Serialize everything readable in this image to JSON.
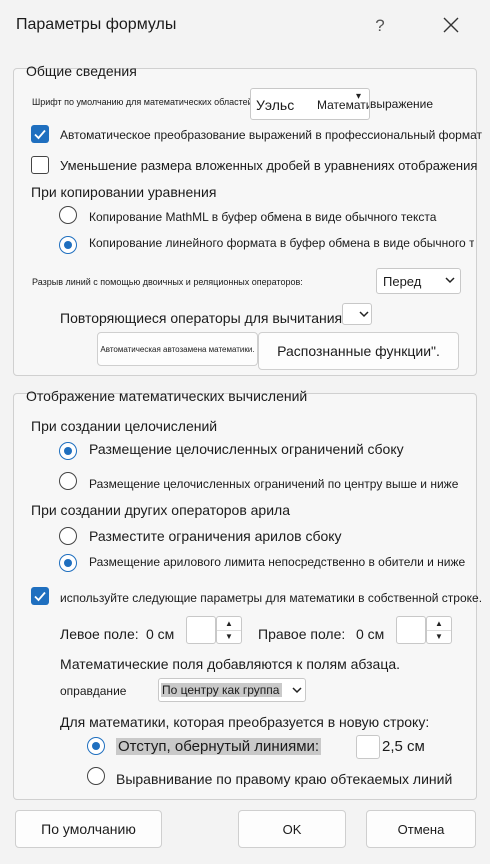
{
  "dialog": {
    "title": "Параметры формулы",
    "help": "?",
    "footer": {
      "defaults_label": "По умолчанию",
      "ok_label": "OK",
      "cancel_label": "Отмена"
    }
  },
  "general": {
    "legend": "Общие сведения",
    "default_font_label": "Шрифт по умолчанию для математических областей:",
    "default_font_value": "Уэльс",
    "default_font_value_tail": "Математическое выражение",
    "auto_convert_label": "Автоматическое преобразование выражений в профессиональный формат",
    "auto_convert_checked": true,
    "reduce_fractions_label": "Уменьшение размера вложенных дробей в уравнениях отображения",
    "reduce_fractions_checked": false,
    "copy_heading": "При копировании уравнения",
    "copy_mathml_label": "Копирование MathML в буфер обмена в виде обычного текста",
    "copy_linear_label": "Копирование линейного формата в буфер обмена в виде обычного текста",
    "copy_selected": "linear",
    "break_lines_label": "Разрыв линий с помощью двоичных и реляционных операторов:",
    "break_lines_value": "Перед",
    "repeat_ops_label": "Повторяющиеся операторы для вычитания:",
    "repeat_ops_value": "",
    "autocorrect_button": "Автоматическая автозамена математики.",
    "recognized_button": "Распознанные функции\"."
  },
  "display": {
    "legend": "Отображение математических вычислений",
    "integrals_heading": "При создании целочислений",
    "integral_side_label": "Размещение целочисленных ограничений сбоку",
    "integral_center_label": "Размещение целочисленных ограничений по центру выше и ниже",
    "integral_selected": "side",
    "nary_heading": "При создании других операторов арила",
    "nary_side_label": "Разместите ограничения арилов сбоку",
    "nary_direct_label": "Размещение арилового лимита непосредственно в обители и ниже",
    "nary_selected": "direct",
    "own_line_label": "используйте следующие параметры для математики в собственной строке.",
    "own_line_checked": true,
    "left_margin_label": "Левое поле:",
    "left_margin_value": "0 см",
    "right_margin_label": "Правое поле:",
    "right_margin_value": "0 см",
    "margins_note": "Математические поля добавляются к полям абзаца.",
    "justify_label": "оправдание",
    "justify_value": "По центру как группа",
    "wrap_heading": "Для математики, которая преобразуется в новую строку:",
    "indent_wrapped_label": "Отступ, обернутый линиями:",
    "indent_wrapped_value": "2,5 см",
    "align_right_label": "Выравнивание по правому краю обтекаемых линий",
    "wrap_selected": "indent"
  },
  "colors": {
    "accent": "#1f6fbf",
    "background": "#f3f3f3",
    "border": "#d0d0d0"
  }
}
